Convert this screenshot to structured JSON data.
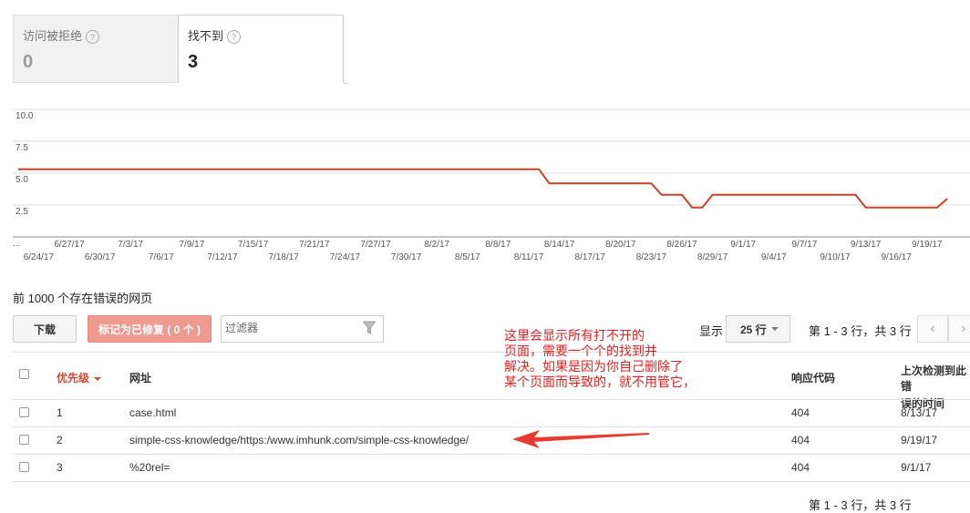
{
  "tabs": [
    {
      "label": "访问被拒绝",
      "count": "0"
    },
    {
      "label": "找不到",
      "count": "3"
    }
  ],
  "chart_data": {
    "type": "line",
    "y_ticks": [
      "10.0",
      "7.5",
      "5.0",
      "2.5"
    ],
    "ylim": [
      0,
      10
    ],
    "x_ticks_top": [
      "6/27/17",
      "7/3/17",
      "7/9/17",
      "7/15/17",
      "7/21/17",
      "7/27/17",
      "8/2/17",
      "8/8/17",
      "8/14/17",
      "8/20/17",
      "8/26/17",
      "9/1/17",
      "9/7/17",
      "9/13/17",
      "9/19/17"
    ],
    "x_ticks_bottom": [
      "6/24/17",
      "6/30/17",
      "7/6/17",
      "7/12/17",
      "7/18/17",
      "7/24/17",
      "7/30/17",
      "8/5/17",
      "8/11/17",
      "8/17/17",
      "8/23/17",
      "8/29/17",
      "9/4/17",
      "9/10/17",
      "9/16/17"
    ],
    "x_start_label": "...",
    "series": [
      {
        "color": "#cc4125",
        "x": [
          "6/22/17",
          "8/12/17",
          "8/13/17",
          "8/23/17",
          "8/24/17",
          "8/26/17",
          "8/27/17",
          "8/28/17",
          "8/29/17",
          "9/12/17",
          "9/13/17",
          "9/20/17",
          "9/21/17"
        ],
        "values": [
          5.3,
          5.3,
          4.2,
          4.2,
          3.3,
          3.3,
          2.3,
          2.3,
          3.3,
          3.3,
          2.3,
          2.3,
          3.0
        ]
      }
    ]
  },
  "section_title": "前 1000 个存在错误的网页",
  "toolbar": {
    "download_label": "下载",
    "mark_fixed_label": "标记为已修复 ( 0 个 )",
    "filter_placeholder": "过滤器",
    "show_label": "显示",
    "rows_option": "25 行",
    "pagination": "第 1 - 3 行，共 3 行"
  },
  "table": {
    "headers": {
      "priority": "优先级",
      "url": "网址",
      "response_code": "响应代码",
      "last_detected_line1": "上次检测到此错",
      "last_detected_line2": "误的时间"
    },
    "rows": [
      {
        "priority": "1",
        "url": "case.html",
        "code": "404",
        "date": "8/13/17"
      },
      {
        "priority": "2",
        "url": "simple-css-knowledge/https:/www.imhunk.com/simple-css-knowledge/",
        "code": "404",
        "date": "9/19/17"
      },
      {
        "priority": "3",
        "url": "%20rel=",
        "code": "404",
        "date": "9/1/17"
      }
    ]
  },
  "annotation": {
    "lines": [
      "这里会显示所有打不开的",
      "页面，需要一个个的找到并",
      "解决。如果是因为你自己删除了",
      "某个页面而导致的，就不用管它，"
    ],
    "color": "#e02020"
  },
  "pagination_bottom": "第 1 - 3 行，共 3 行"
}
